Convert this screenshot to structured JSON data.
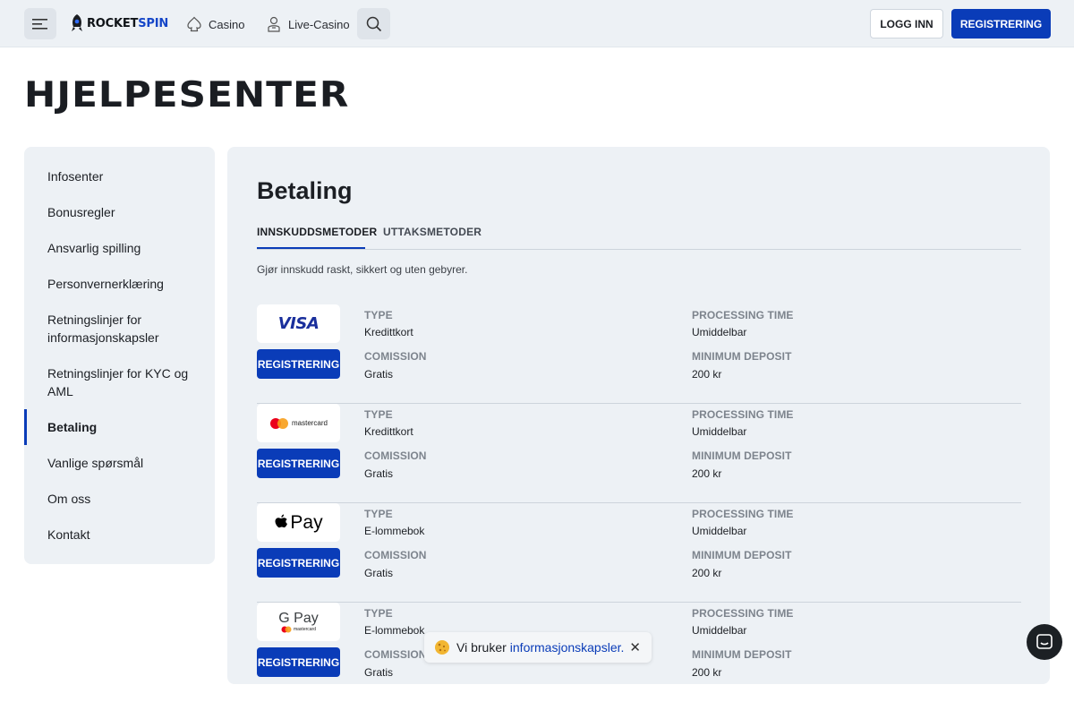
{
  "header": {
    "logo_prefix": "ROCKET",
    "logo_suffix": "SPIN",
    "nav": [
      {
        "label": "Casino",
        "icon": "spade-icon"
      },
      {
        "label": "Live-Casino",
        "icon": "dealer-icon"
      }
    ],
    "login_label": "LOGG INN",
    "register_label": "REGISTRERING"
  },
  "page_title": "HJELPESENTER",
  "sidebar": {
    "items": [
      {
        "label": "Infosenter"
      },
      {
        "label": "Bonusregler"
      },
      {
        "label": "Ansvarlig spilling"
      },
      {
        "label": "Personvernerklæring"
      },
      {
        "label": "Retningslinjer for informasjonskapsler"
      },
      {
        "label": "Retningslinjer for KYC og AML"
      },
      {
        "label": "Betaling",
        "active": true
      },
      {
        "label": "Vanlige spørsmål"
      },
      {
        "label": "Om oss"
      },
      {
        "label": "Kontakt"
      }
    ]
  },
  "main": {
    "title": "Betaling",
    "tabs": [
      {
        "label": "INNSKUDDSMETODER",
        "active": true
      },
      {
        "label": "UTTAKSMETODER",
        "active": false
      }
    ],
    "intro": "Gjør innskudd raskt, sikkert og uten gebyrer.",
    "labels": {
      "type": "TYPE",
      "commission": "COMISSION",
      "processing": "PROCESSING TIME",
      "minimum": "MINIMUM DEPOSIT"
    },
    "methods": [
      {
        "logo": "VISA",
        "button": "REGISTRERING",
        "type": "Kredittkort",
        "commission": "Gratis",
        "processing": "Umiddelbar",
        "minimum": "200 kr"
      },
      {
        "logo": "mastercard",
        "button": "REGISTRERING",
        "type": "Kredittkort",
        "commission": "Gratis",
        "processing": "Umiddelbar",
        "minimum": "200 kr"
      },
      {
        "logo": "Pay",
        "button": "REGISTRERING",
        "type": "E-lommebok",
        "commission": "Gratis",
        "processing": "Umiddelbar",
        "minimum": "200 kr"
      },
      {
        "logo": "G Pay",
        "logo_sub": "mastercard",
        "button": "REGISTRERING",
        "type": "E-lommebok",
        "commission": "Gratis",
        "processing": "Umiddelbar",
        "minimum": "200 kr"
      }
    ]
  },
  "cookie": {
    "text": "Vi bruker",
    "link": "informasjonskapsler."
  },
  "colors": {
    "accent": "#0a3cb8",
    "panel": "#edf1f5"
  }
}
